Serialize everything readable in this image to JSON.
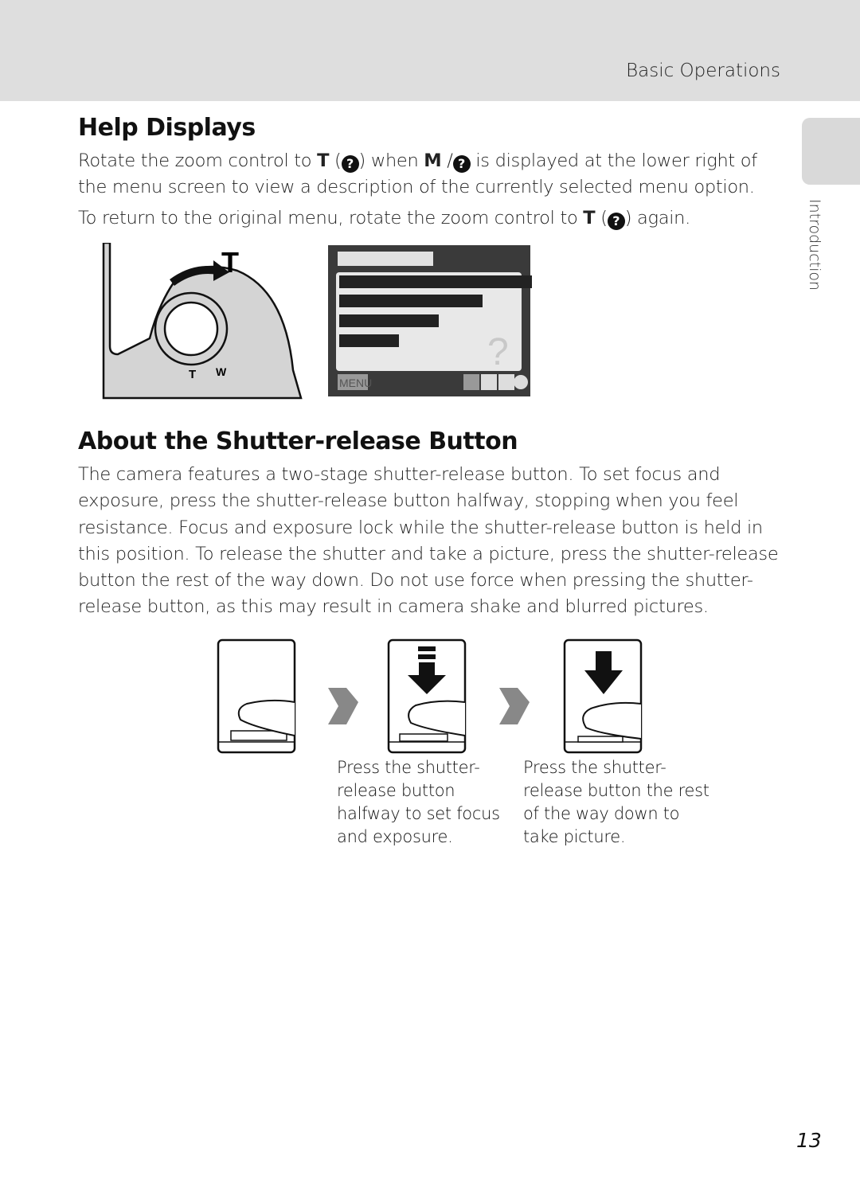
{
  "header": {
    "section": "Basic Operations"
  },
  "side_tab": {
    "label": "Introduction"
  },
  "help": {
    "title": "Help Displays",
    "p1_a": "Rotate the zoom control to ",
    "p1_t": "T",
    "p1_b": " when ",
    "p1_m": "M",
    "p1_c": " is displayed at the lower right of the menu screen to view a description of the currently selected menu option.",
    "p2_a": "To return to the original menu, rotate the zoom control to ",
    "p2_t": "T",
    "p2_b": " again.",
    "help_glyph": "?",
    "figure": {
      "zoom_t": "T",
      "zoom_w": "W",
      "menu_label": "MENU"
    }
  },
  "shutter": {
    "title": "About the Shutter-release Button",
    "body": "The camera features a two-stage shutter-release button. To set focus and exposure, press the shutter-release button halfway, stopping when you feel resistance. Focus and exposure lock while the shutter-release button is held in this position. To release the shutter and take a picture, press the shutter-release button the rest of the way down. Do not use force when pressing the shutter-release button, as this may result in camera shake and blurred pictures.",
    "captions": [
      "Press the shutter-release button halfway to set focus and exposure.",
      "Press the shutter-release button the rest of the way down to take picture."
    ],
    "caption_lines": [
      [
        "Press the shutter-",
        "release button",
        "halfway to set focus",
        "and exposure."
      ],
      [
        "Press the shutter-",
        "release button the rest",
        "of the way down to",
        "take picture."
      ]
    ]
  },
  "page_number": "13"
}
